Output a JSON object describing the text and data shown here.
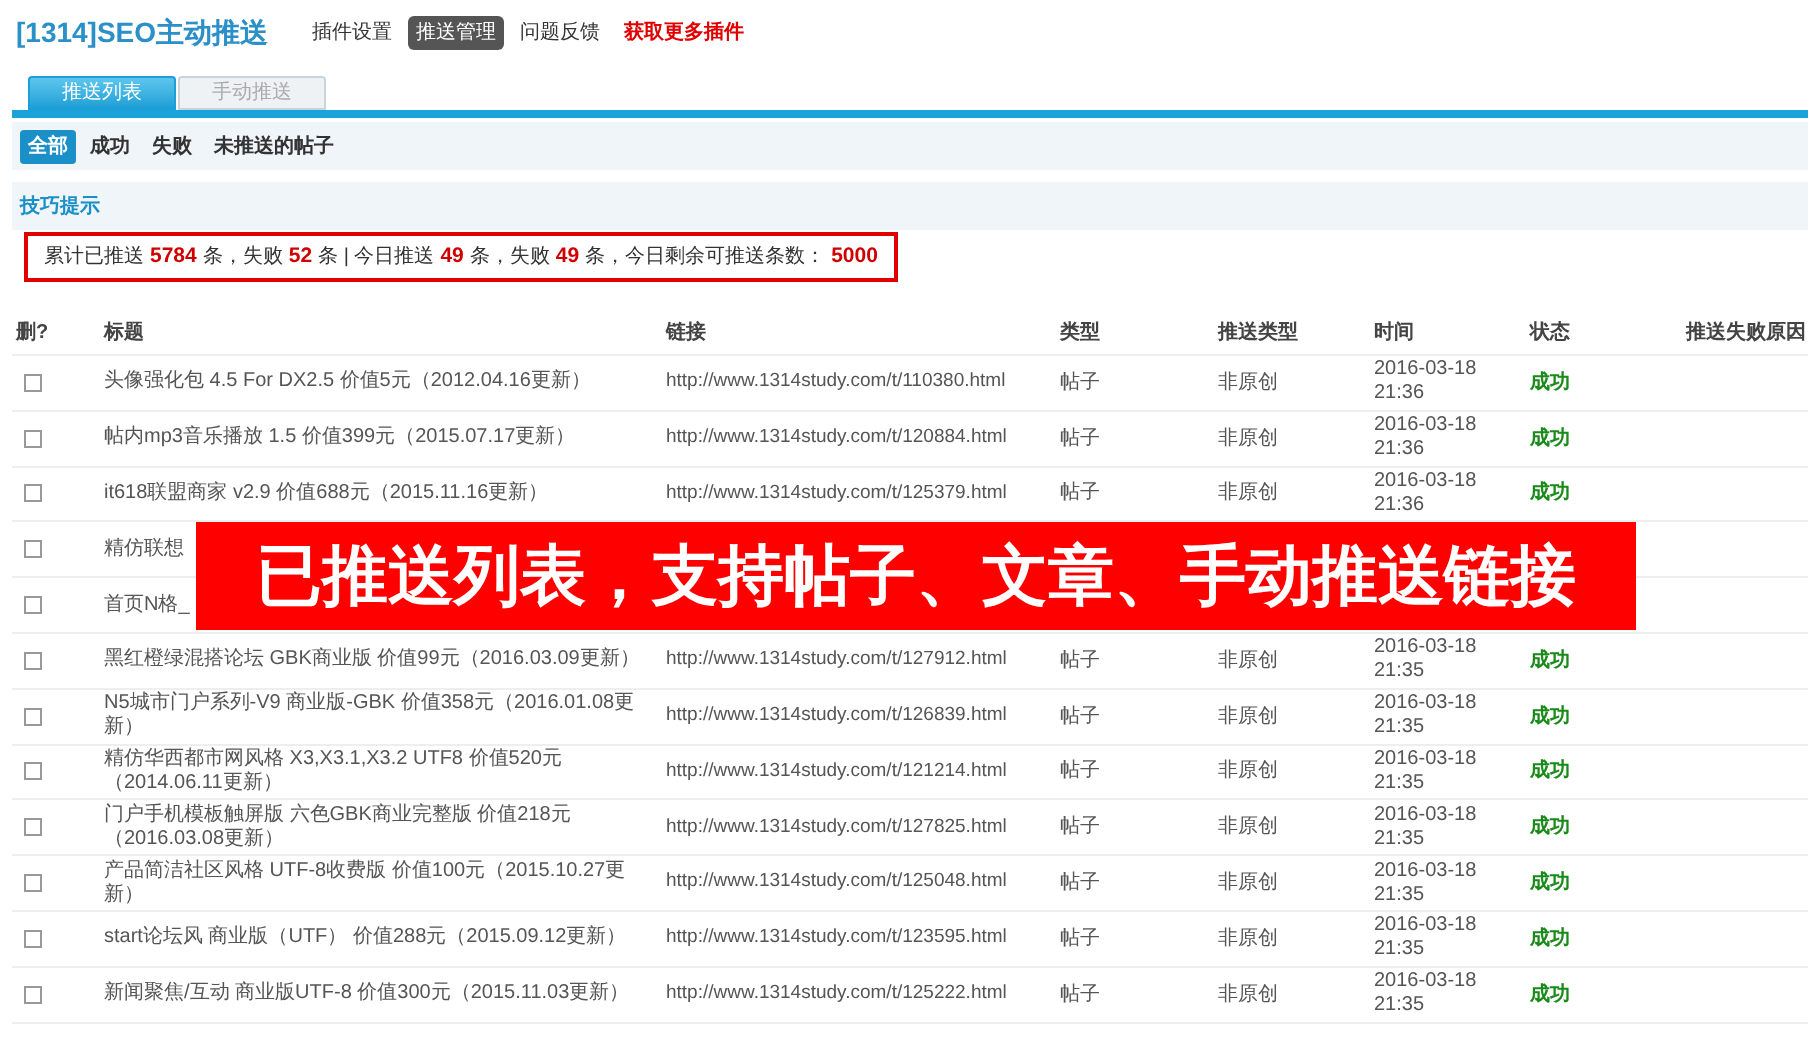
{
  "header": {
    "title": "[1314]SEO主动推送",
    "nav": [
      {
        "label": "插件设置",
        "kind": "tab",
        "selected": false
      },
      {
        "label": "推送管理",
        "kind": "tab",
        "selected": true
      },
      {
        "label": "问题反馈",
        "kind": "tab",
        "selected": false
      },
      {
        "label": "获取更多插件",
        "kind": "promo",
        "selected": false
      }
    ]
  },
  "tabs": [
    {
      "label": "推送列表",
      "selected": true
    },
    {
      "label": "手动推送",
      "selected": false
    }
  ],
  "filters": [
    {
      "label": "全部",
      "selected": true
    },
    {
      "label": "成功",
      "selected": false
    },
    {
      "label": "失败",
      "selected": false
    },
    {
      "label": "未推送的帖子",
      "selected": false
    }
  ],
  "tips": {
    "title": "技巧提示",
    "stats": [
      {
        "kind": "text",
        "text": "累计已推送"
      },
      {
        "kind": "number",
        "text": "5784"
      },
      {
        "kind": "text",
        "text": "条，失败"
      },
      {
        "kind": "number",
        "text": "52"
      },
      {
        "kind": "text",
        "text": "条 | 今日推送"
      },
      {
        "kind": "number",
        "text": "49"
      },
      {
        "kind": "text",
        "text": "条，失败"
      },
      {
        "kind": "number",
        "text": "49"
      },
      {
        "kind": "text",
        "text": "条，今日剩余可推送条数："
      },
      {
        "kind": "number",
        "text": "5000"
      }
    ]
  },
  "table": {
    "columns": [
      "删?",
      "标题",
      "链接",
      "类型",
      "推送类型",
      "时间",
      "状态",
      "推送失败原因"
    ],
    "rows": [
      {
        "checked": false,
        "title": "头像强化包 4.5 For DX2.5 价值5元（2012.04.16更新）",
        "link": "http://www.1314study.com/t/110380.html",
        "type": "帖子",
        "push_type": "非原创",
        "time": "2016-03-18 21:36",
        "status": "成功",
        "success": true
      },
      {
        "checked": false,
        "title": "帖内mp3音乐播放 1.5 价值399元（2015.07.17更新）",
        "link": "http://www.1314study.com/t/120884.html",
        "type": "帖子",
        "push_type": "非原创",
        "time": "2016-03-18 21:36",
        "status": "成功",
        "success": true
      },
      {
        "checked": false,
        "title": "it618联盟商家 v2.9 价值688元（2015.11.16更新）",
        "link": "http://www.1314study.com/t/125379.html",
        "type": "帖子",
        "push_type": "非原创",
        "time": "2016-03-18 21:36",
        "status": "成功",
        "success": true
      },
      {
        "checked": false,
        "title": "精仿联想"
      },
      {
        "checked": false,
        "title": "首页N格_"
      },
      {
        "checked": false,
        "title": "黑红橙绿混搭论坛 GBK商业版 价值99元（2016.03.09更新）",
        "link": "http://www.1314study.com/t/127912.html",
        "type": "帖子",
        "push_type": "非原创",
        "time": "2016-03-18 21:35",
        "status": "成功",
        "success": true
      },
      {
        "checked": false,
        "title": "N5城市门户系列-V9 商业版-GBK 价值358元（2016.01.08更新）",
        "link": "http://www.1314study.com/t/126839.html",
        "type": "帖子",
        "push_type": "非原创",
        "time": "2016-03-18 21:35",
        "status": "成功",
        "success": true
      },
      {
        "checked": false,
        "title": "精仿华西都市网风格 X3,X3.1,X3.2 UTF8 价值520元（2014.06.11更新）",
        "link": "http://www.1314study.com/t/121214.html",
        "type": "帖子",
        "push_type": "非原创",
        "time": "2016-03-18 21:35",
        "status": "成功",
        "success": true
      },
      {
        "checked": false,
        "title": "门户手机模板触屏版 六色GBK商业完整版 价值218元（2016.03.08更新）",
        "link": "http://www.1314study.com/t/127825.html",
        "type": "帖子",
        "push_type": "非原创",
        "time": "2016-03-18 21:35",
        "status": "成功",
        "success": true
      },
      {
        "checked": false,
        "title": "产品简洁社区风格 UTF-8收费版 价值100元（2015.10.27更新）",
        "link": "http://www.1314study.com/t/125048.html",
        "type": "帖子",
        "push_type": "非原创",
        "time": "2016-03-18 21:35",
        "status": "成功",
        "success": true
      },
      {
        "checked": false,
        "title": "start论坛风 商业版（UTF） 价值288元（2015.09.12更新）",
        "link": "http://www.1314study.com/t/123595.html",
        "type": "帖子",
        "push_type": "非原创",
        "time": "2016-03-18 21:35",
        "status": "成功",
        "success": true
      },
      {
        "checked": false,
        "title": "新闻聚焦/互动 商业版UTF-8 价值300元（2015.11.03更新）",
        "link": "http://www.1314study.com/t/125222.html",
        "type": "帖子",
        "push_type": "非原创",
        "time": "2016-03-18 21:35",
        "status": "成功",
        "success": true
      }
    ]
  },
  "banner": {
    "text": "已推送列表，支持帖子、文章、手动推送链接"
  }
}
